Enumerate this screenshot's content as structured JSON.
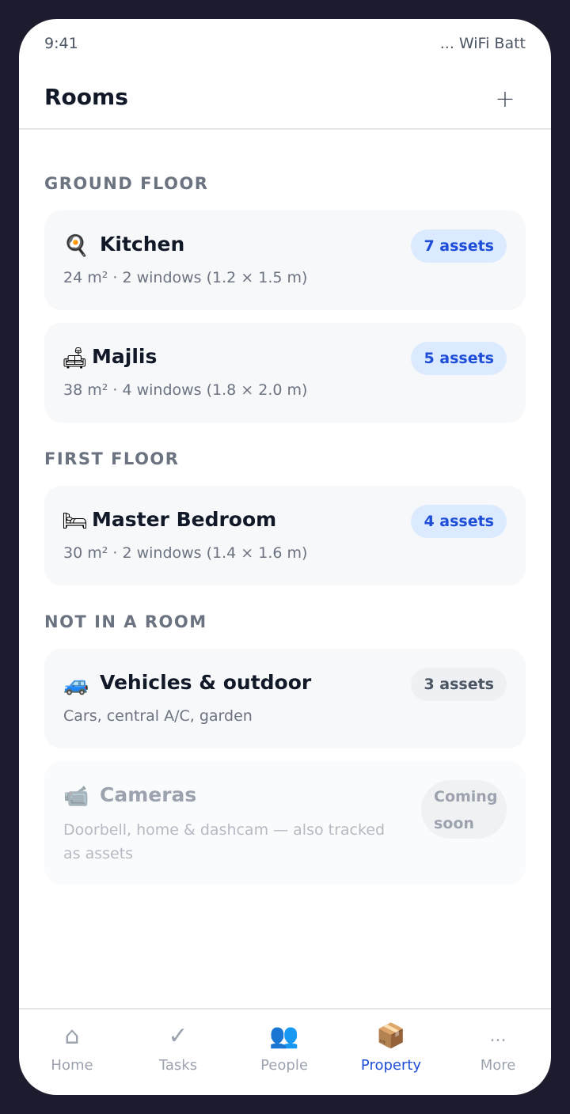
{
  "status_bar": {
    "time": "9:41",
    "right": "... WiFi Batt"
  },
  "header": {
    "title": "Rooms",
    "add_label": "+"
  },
  "sections": [
    {
      "label": "GROUND FLOOR"
    },
    {
      "label": "FIRST FLOOR"
    },
    {
      "label": "NOT IN A ROOM"
    }
  ],
  "rooms": [
    {
      "icon": "🍳",
      "icon_name": "frying-pan-icon",
      "title": "Kitchen",
      "subtitle": "24 m² · 2 windows (1.2 × 1.5 m)",
      "badge": "7 assets"
    },
    {
      "icon": "🛋",
      "icon_name": "couch-icon",
      "title": "Majlis",
      "subtitle": "38 m² · 4 windows (1.8 × 2.0 m)",
      "badge": "5 assets"
    },
    {
      "icon": "🛏",
      "icon_name": "bed-icon",
      "title": "Master Bedroom",
      "subtitle": "30 m² · 2 windows (1.4 × 1.6 m)",
      "badge": "4 assets"
    },
    {
      "icon": "🚙",
      "icon_name": "car-icon",
      "title": "Vehicles & outdoor",
      "subtitle": "Cars, central A/C, garden",
      "badge": "3 assets"
    },
    {
      "icon": "📹",
      "icon_name": "video-camera-icon",
      "title": "Cameras",
      "subtitle": "Doorbell, home & dashcam — also tracked as assets",
      "badge": "Coming soon"
    }
  ],
  "tabs": [
    {
      "label": "Home",
      "icon": "⌂",
      "icon_name": "home-icon"
    },
    {
      "label": "Tasks",
      "icon": "✓",
      "icon_name": "check-icon"
    },
    {
      "label": "People",
      "icon": "👥",
      "icon_name": "people-icon"
    },
    {
      "label": "Property",
      "icon": "📦",
      "icon_name": "package-icon",
      "active": true
    },
    {
      "label": "More",
      "icon": "...",
      "icon_name": "more-icon"
    }
  ],
  "colors": {
    "accent": "#1e4ed8",
    "badge_bg": "#dbeafe",
    "frame": "#1c1c2e"
  }
}
